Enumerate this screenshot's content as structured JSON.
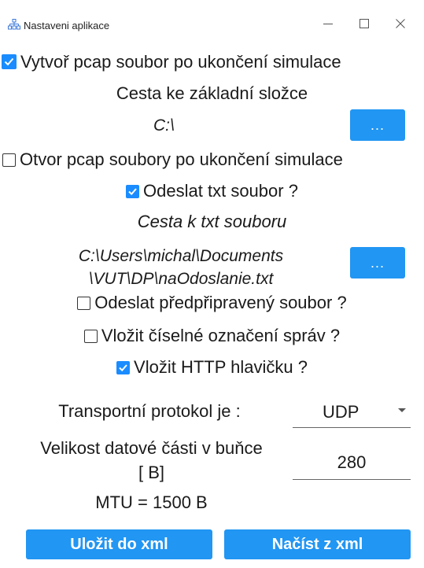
{
  "window": {
    "title": "Nastaveni aplikace",
    "icon": "network-icon",
    "controls": [
      "minimize-icon",
      "maximize-icon",
      "close-icon"
    ]
  },
  "pcap": {
    "create_checkbox_label": "Vytvoř pcap soubor po ukončení simulace",
    "create_checked": true,
    "folder_label": "Cesta ke základní složce",
    "folder_path": "C:\\",
    "browse_label": "...",
    "open_checkbox_label": "Otvor pcap soubory po ukončení simulace",
    "open_checked": false
  },
  "txt": {
    "send_checkbox_label": "Odeslat txt soubor ?",
    "send_checked": true,
    "path_label": "Cesta k txt souboru",
    "path_line1": "C:\\Users\\michal\\Documents",
    "path_line2": "\\VUT\\DP\\naOdoslanie.txt",
    "browse_label": "..."
  },
  "options": {
    "prepared_label": "Odeslat předpřipravený soubor ?",
    "prepared_checked": false,
    "numbering_label": "Vložit číselné označení správ ?",
    "numbering_checked": false,
    "http_label": "Vložit HTTP hlavičku ?",
    "http_checked": true
  },
  "transport": {
    "label": "Transportní protokol je :",
    "value": "UDP"
  },
  "payload": {
    "label_line1": "Velikost datové části v buňce",
    "label_line2": "[ B]",
    "value": "280",
    "mtu": "MTU = 1500 B"
  },
  "buttons": {
    "save": "Uložit do xml",
    "load": "Načíst z xml"
  },
  "colors": {
    "accent": "#2196f3",
    "checkbox": "#1a8cff"
  }
}
